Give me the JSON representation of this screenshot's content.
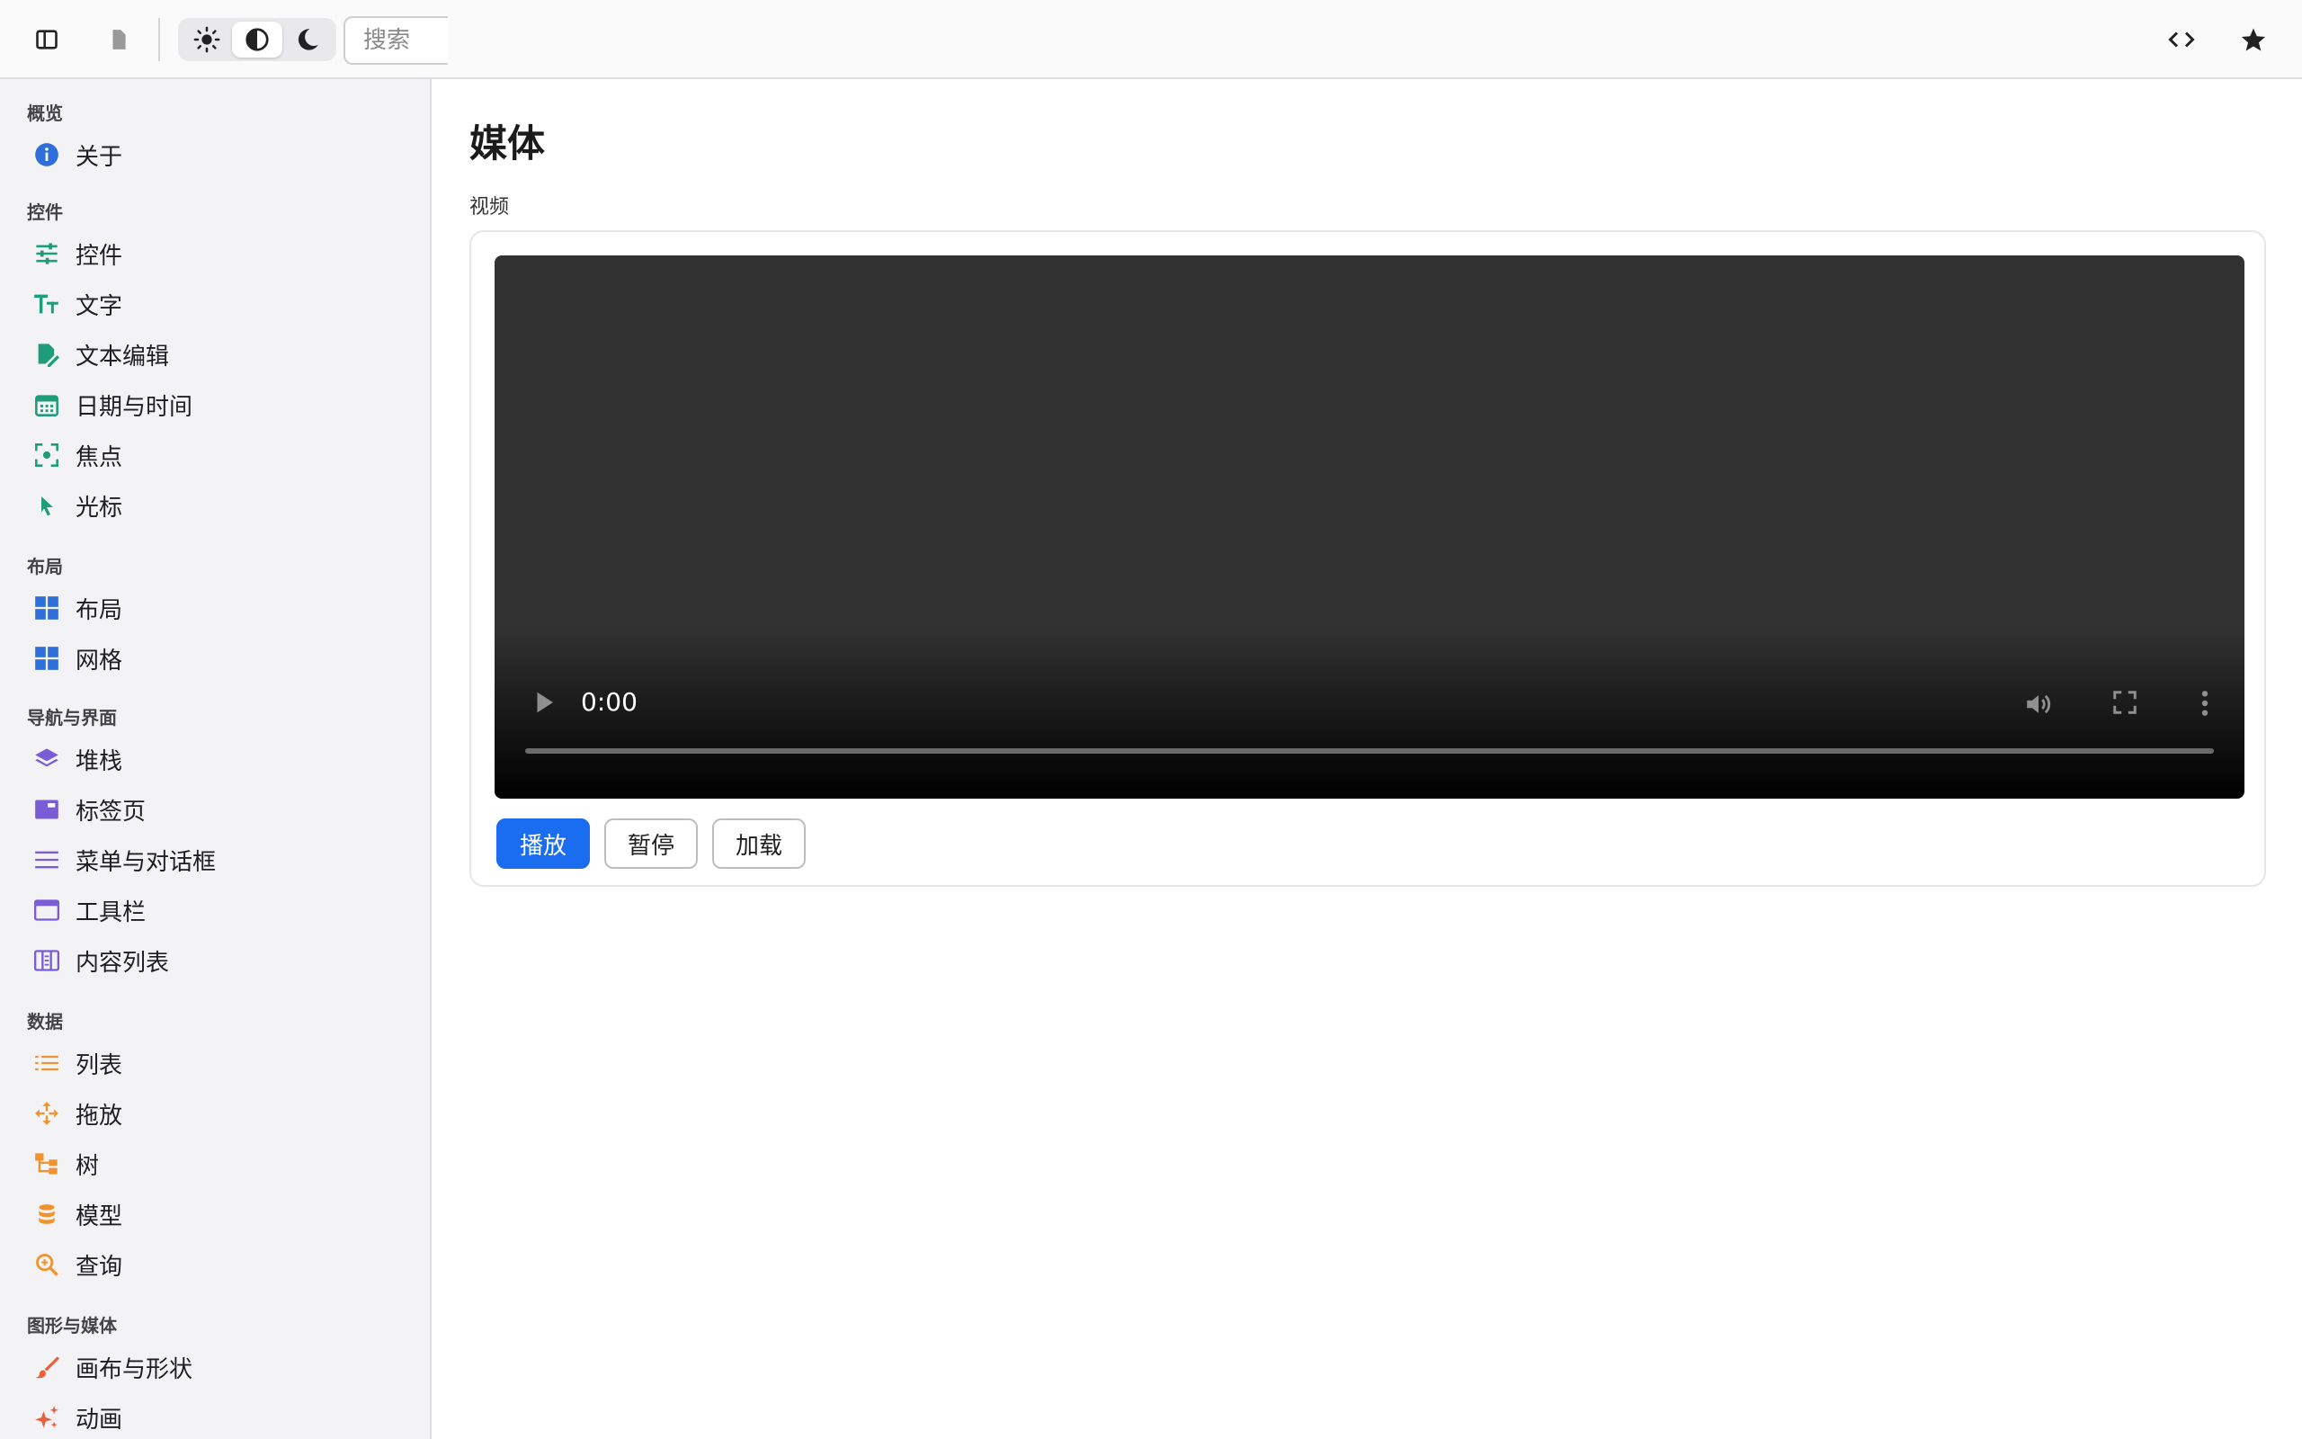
{
  "toolbar": {
    "search_placeholder": "搜索",
    "buttons": [
      "sidebar-toggle",
      "document",
      "theme-light",
      "theme-auto",
      "theme-dark",
      "code",
      "star"
    ]
  },
  "sidebar": {
    "sections": [
      {
        "title": "概览",
        "items": [
          {
            "label": "关于",
            "icon": "info-icon",
            "color": "#2f6fdb"
          }
        ]
      },
      {
        "title": "控件",
        "items": [
          {
            "label": "控件",
            "icon": "sliders-icon",
            "color": "#1f9c7a"
          },
          {
            "label": "文字",
            "icon": "text-size-icon",
            "color": "#1f9c7a"
          },
          {
            "label": "文本编辑",
            "icon": "edit-document-icon",
            "color": "#1f9c7a"
          },
          {
            "label": "日期与时间",
            "icon": "calendar-icon",
            "color": "#1f9c7a"
          },
          {
            "label": "焦点",
            "icon": "focus-icon",
            "color": "#1f9c7a"
          },
          {
            "label": "光标",
            "icon": "cursor-icon",
            "color": "#1f9c7a"
          }
        ]
      },
      {
        "title": "布局",
        "items": [
          {
            "label": "布局",
            "icon": "grid-icon",
            "color": "#2f6fdb"
          },
          {
            "label": "网格",
            "icon": "grid-icon",
            "color": "#2f6fdb"
          }
        ]
      },
      {
        "title": "导航与界面",
        "items": [
          {
            "label": "堆栈",
            "icon": "layers-icon",
            "color": "#7a5cd6"
          },
          {
            "label": "标签页",
            "icon": "tabs-icon",
            "color": "#7a5cd6"
          },
          {
            "label": "菜单与对话框",
            "icon": "menu-icon",
            "color": "#7a5cd6"
          },
          {
            "label": "工具栏",
            "icon": "window-icon",
            "color": "#7a5cd6"
          },
          {
            "label": "内容列表",
            "icon": "columns-icon",
            "color": "#7a5cd6"
          }
        ]
      },
      {
        "title": "数据",
        "items": [
          {
            "label": "列表",
            "icon": "list-icon",
            "color": "#f0922e"
          },
          {
            "label": "拖放",
            "icon": "move-icon",
            "color": "#f0922e"
          },
          {
            "label": "树",
            "icon": "tree-icon",
            "color": "#f0922e"
          },
          {
            "label": "模型",
            "icon": "database-icon",
            "color": "#f0922e"
          },
          {
            "label": "查询",
            "icon": "search-zoom-icon",
            "color": "#f0922e"
          }
        ]
      },
      {
        "title": "图形与媒体",
        "items": [
          {
            "label": "画布与形状",
            "icon": "brush-icon",
            "color": "#e8613c"
          },
          {
            "label": "动画",
            "icon": "sparkle-icon",
            "color": "#e8613c"
          }
        ]
      }
    ]
  },
  "main": {
    "title": "媒体",
    "section_label": "视频",
    "video": {
      "time": "0:00",
      "progress": 0
    },
    "buttons": {
      "play": "播放",
      "pause": "暂停",
      "load": "加载"
    },
    "accent": "#1a6cf0"
  }
}
